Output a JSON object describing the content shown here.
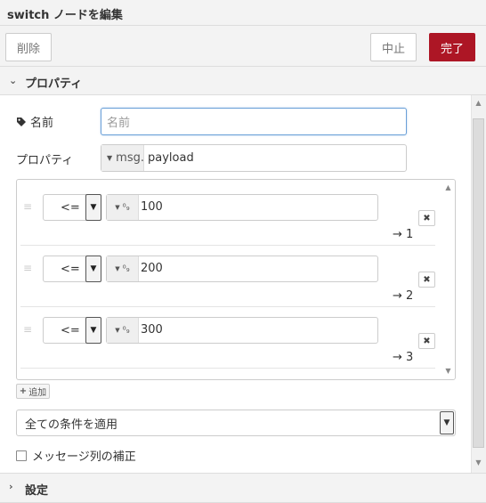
{
  "tray": {
    "title": "switch ノードを編集"
  },
  "toolbar": {
    "delete_label": "削除",
    "cancel_label": "中止",
    "done_label": "完了"
  },
  "sections": {
    "properties_label": "プロパティ",
    "settings_label": "設定"
  },
  "form": {
    "name_label": "名前",
    "name_placeholder": "名前",
    "name_value": "",
    "property_label": "プロパティ",
    "property_type": "msg.",
    "property_value": "payload"
  },
  "rules": [
    {
      "operator": "<=",
      "value_type": "0-9",
      "value": "100",
      "output": "→ 1"
    },
    {
      "operator": "<=",
      "value_type": "0-9",
      "value": "200",
      "output": "→ 2"
    },
    {
      "operator": "<=",
      "value_type": "0-9",
      "value": "300",
      "output": "→ 3"
    }
  ],
  "add_button_label": "追加",
  "rule_mode": "全ての条件を適用",
  "repair_label": "メッセージ列の補正",
  "repair_checked": false,
  "colors": {
    "accent": "#ad1625",
    "focus": "#6aa0d8",
    "panel_bg": "#f3f3f3"
  }
}
